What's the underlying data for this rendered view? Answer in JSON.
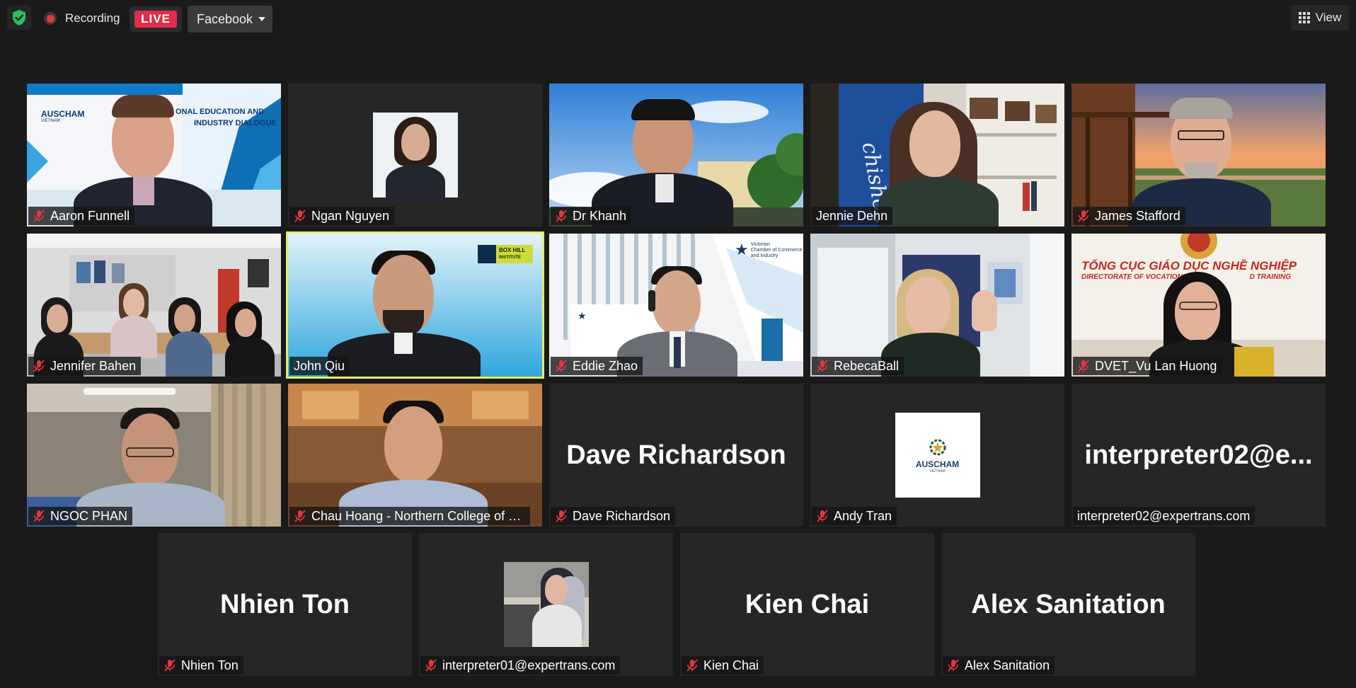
{
  "topbar": {
    "security": "shield-check-icon",
    "recording_label": "Recording",
    "live_label": "LIVE",
    "platform_label": "Facebook",
    "view_label": "View"
  },
  "colors": {
    "background": "#1a1a1a",
    "tile": "#262626",
    "live": "#e02e48",
    "active_speaker": "#e3ec6f",
    "mute": "#e0383e",
    "shield": "#22c55e"
  },
  "participants": [
    {
      "name": "Aaron Funnell",
      "muted": true,
      "mode": "video"
    },
    {
      "name": "Ngan Nguyen",
      "muted": true,
      "mode": "photo"
    },
    {
      "name": "Dr Khanh",
      "muted": true,
      "mode": "video"
    },
    {
      "name": "Jennie Dehn",
      "muted": false,
      "mode": "video"
    },
    {
      "name": "James Stafford",
      "muted": true,
      "mode": "video"
    },
    {
      "name": "Jennifer Bahen",
      "muted": true,
      "mode": "video"
    },
    {
      "name": "John Qiu",
      "muted": false,
      "mode": "video",
      "active_speaker": true
    },
    {
      "name": "Eddie Zhao",
      "muted": true,
      "mode": "video"
    },
    {
      "name": "RebecaBall",
      "muted": true,
      "mode": "video"
    },
    {
      "name": "DVET_Vu Lan Huong",
      "muted": true,
      "mode": "video"
    },
    {
      "name": "NGOC PHAN",
      "muted": true,
      "mode": "video"
    },
    {
      "name": "Chau Hoang - Northern College of L...",
      "muted": true,
      "mode": "video"
    },
    {
      "name": "Dave Richardson",
      "muted": true,
      "mode": "name",
      "display": "Dave Richardson"
    },
    {
      "name": "Andy Tran",
      "muted": true,
      "mode": "logo"
    },
    {
      "name": "interpreter02@expertrans.com",
      "muted": false,
      "mode": "name",
      "display": "interpreter02@e..."
    },
    {
      "name": "Nhien Ton",
      "muted": true,
      "mode": "name",
      "display": "Nhien Ton"
    },
    {
      "name": "interpreter01@expertrans.com",
      "muted": true,
      "mode": "photo"
    },
    {
      "name": "Kien Chai",
      "muted": true,
      "mode": "name",
      "display": "Kien Chai"
    },
    {
      "name": "Alex Sanitation",
      "muted": true,
      "mode": "name",
      "display": "Alex Sanitation"
    }
  ],
  "backgrounds": {
    "t0": {
      "top": "AUSCHAM",
      "sub": "VIETNAM",
      "banner": "ONAL EDUCATION AND",
      "banner2": "INDUSTRY DIALOGUE"
    },
    "t3": {
      "banner": "chisholm"
    },
    "t6": {
      "logo": "BOX HILL",
      "logo2": "INSTITUTE"
    },
    "t7": {
      "org": "Victorian",
      "org2": "Chamber of Commerce",
      "org3": "and Industry"
    },
    "t9": {
      "banner": "TỔNG CỤC GIÁO DỤC NGHỀ NGHIỆP",
      "banner2": "DIRECTORATE OF VOCATIONAL",
      "banner3": "D TRAINING"
    },
    "t13": {
      "logo": "AUSCHAM",
      "sub": "VIETNAM"
    }
  }
}
